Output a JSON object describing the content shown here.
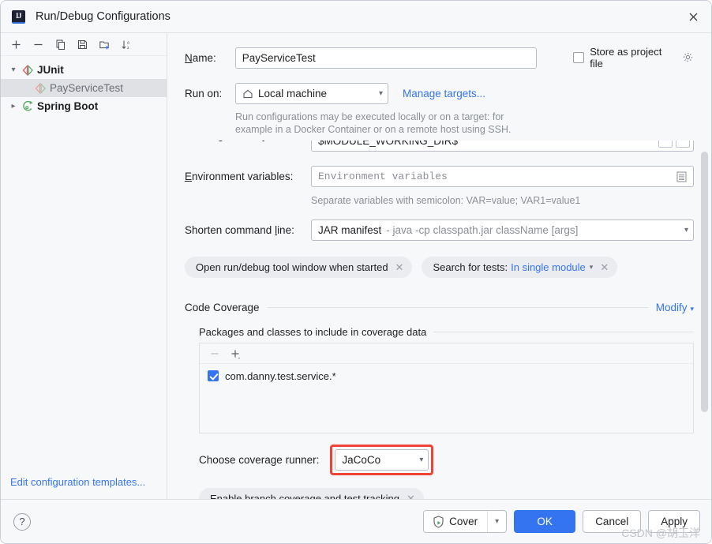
{
  "window": {
    "title": "Run/Debug Configurations",
    "app_icon": "intellij-idea-icon",
    "close_icon": "close-icon"
  },
  "sidebar": {
    "toolbar": [
      {
        "name": "add-configuration-button",
        "icon": "plus-icon",
        "label": "+"
      },
      {
        "name": "remove-configuration-button",
        "icon": "minus-icon",
        "label": "−"
      },
      {
        "name": "copy-configuration-button",
        "icon": "copy-icon",
        "label": ""
      },
      {
        "name": "save-configuration-button",
        "icon": "save-icon",
        "label": ""
      },
      {
        "name": "new-folder-button",
        "icon": "new-folder-icon",
        "label": ""
      },
      {
        "name": "sort-configurations-button",
        "icon": "sort-alphabetically-icon",
        "label": ""
      }
    ],
    "tree": [
      {
        "label": "JUnit",
        "icon": "junit-icon",
        "expanded": true,
        "level": 0,
        "selected": false
      },
      {
        "label": "PayServiceTest",
        "icon": "junit-run-icon",
        "level": 1,
        "selected": true
      },
      {
        "label": "Spring Boot",
        "icon": "spring-boot-icon",
        "expanded": false,
        "level": 0,
        "selected": false
      }
    ],
    "edit_templates_link": "Edit configuration templates..."
  },
  "form": {
    "name_label": "Name:",
    "name_value": "PayServiceTest",
    "store_as_project_file_label": "Store as project file",
    "store_as_project_file_checked": false,
    "store_gear_icon": "gear-icon",
    "run_on_label": "Run on:",
    "run_on_value": "Local machine",
    "run_on_icon": "home-icon",
    "manage_targets_link": "Manage targets...",
    "run_on_hint_line1": "Run configurations may be executed locally or on a target: for",
    "run_on_hint_line2": "example in a Docker Container or on a remote host using SSH.",
    "working_directory_label": "Working directory:",
    "working_directory_value": "$MODULE_WORKING_DIR$",
    "environment_variables_label": "Environment variables:",
    "environment_variables_placeholder": "Environment variables",
    "environment_variables_value": "",
    "environment_hint": "Separate variables with semicolon: VAR=value; VAR1=value1",
    "shorten_command_line_label": "Shorten command line:",
    "shorten_command_line_value": "JAR manifest",
    "shorten_command_line_detail": "- java -cp classpath.jar className [args]"
  },
  "chips": [
    {
      "name": "chip-open-run-debug-tool-window",
      "label": "Open run/debug tool window when started",
      "link": "",
      "has_dropdown": false,
      "close_icon": "close-icon"
    },
    {
      "name": "chip-search-for-tests",
      "label": "Search for tests:",
      "link": "In single module",
      "has_dropdown": true,
      "close_icon": "close-icon"
    }
  ],
  "code_coverage": {
    "section_title": "Code Coverage",
    "modify_label": "Modify",
    "modify_chevron": "chevron-down-icon",
    "packages_title": "Packages and classes to include in coverage data",
    "list_toolbar": [
      {
        "name": "remove-package-button",
        "icon": "minus-icon",
        "label": "−",
        "disabled": true
      },
      {
        "name": "add-package-button",
        "icon": "plus-icon",
        "label": "+",
        "disabled": false
      }
    ],
    "packages": [
      {
        "label": "com.danny.test.service.*",
        "checked": true
      }
    ],
    "runner_label": "Choose coverage runner:",
    "runner_value": "JaCoCo",
    "runner_highlight_color": "#f04438",
    "branch_chip": {
      "name": "chip-enable-branch-coverage",
      "label": "Enable branch coverage and test tracking",
      "close_icon": "close-icon"
    }
  },
  "footer": {
    "help_label": "?",
    "cover_label": "Cover",
    "cover_icon": "coverage-shield-run-icon",
    "cover_dropdown_icon": "chevron-down-icon",
    "ok_label": "OK",
    "cancel_label": "Cancel",
    "apply_label": "Apply"
  },
  "watermark": "CSDN @胡玉洋",
  "colors": {
    "accent": "#3574f0",
    "highlight": "#f04438",
    "background": "#f7f8fa",
    "field_background": "#ffffff"
  }
}
